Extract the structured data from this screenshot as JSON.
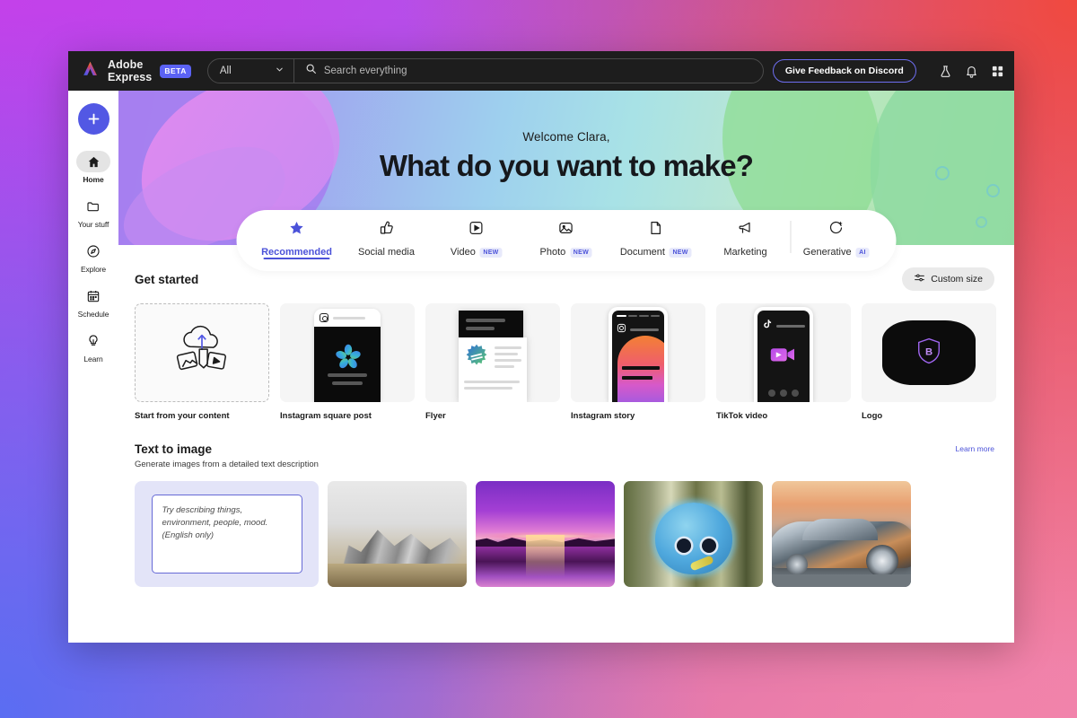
{
  "app": {
    "brand_name": "Adobe Express",
    "beta_label": "BETA"
  },
  "topbar": {
    "scope_value": "All",
    "search_placeholder": "Search everything",
    "feedback_label": "Give Feedback on Discord",
    "icons": [
      "flask-icon",
      "bell-icon",
      "apps-grid-icon",
      "help-icon",
      "creative-cloud-icon"
    ]
  },
  "sidebar": {
    "create_label": "+",
    "items": [
      {
        "label": "Home",
        "icon": "home-icon",
        "active": true
      },
      {
        "label": "Your stuff",
        "icon": "folder-icon",
        "active": false
      },
      {
        "label": "Explore",
        "icon": "compass-icon",
        "active": false
      },
      {
        "label": "Schedule",
        "icon": "calendar-icon",
        "active": false
      },
      {
        "label": "Learn",
        "icon": "lightbulb-icon",
        "active": false
      }
    ]
  },
  "hero": {
    "welcome": "Welcome Clara,",
    "question": "What do you want to make?"
  },
  "tabs": [
    {
      "label": "Recommended",
      "icon": "star-icon",
      "badge": "",
      "active": true
    },
    {
      "label": "Social media",
      "icon": "thumbs-up-icon",
      "badge": "",
      "active": false
    },
    {
      "label": "Video",
      "icon": "play-icon",
      "badge": "NEW",
      "active": false
    },
    {
      "label": "Photo",
      "icon": "image-icon",
      "badge": "NEW",
      "active": false
    },
    {
      "label": "Document",
      "icon": "page-icon",
      "badge": "NEW",
      "active": false
    },
    {
      "label": "Marketing",
      "icon": "megaphone-icon",
      "badge": "",
      "active": false
    },
    {
      "label": "Generative",
      "icon": "sparkle-camera-icon",
      "badge": "AI",
      "active": false
    }
  ],
  "get_started": {
    "title": "Get started",
    "custom_size_label": "Custom size",
    "cards": [
      {
        "label": "Start from your content",
        "kind": "upload"
      },
      {
        "label": "Instagram square post",
        "kind": "ig-post"
      },
      {
        "label": "Flyer",
        "kind": "flyer"
      },
      {
        "label": "Instagram story",
        "kind": "ig-story"
      },
      {
        "label": "TikTok video",
        "kind": "tiktok"
      },
      {
        "label": "Logo",
        "kind": "logo"
      }
    ]
  },
  "text_to_image": {
    "title": "Text to image",
    "subtitle": "Generate images from a detailed text description",
    "learn_more_label": "Learn more",
    "prompt_placeholder": "Try describing things, environment, people, mood. (English only)",
    "samples": [
      {
        "name": "black-and-white-mountains"
      },
      {
        "name": "purple-sunset-lake"
      },
      {
        "name": "blue-fluffy-creature"
      },
      {
        "name": "futuristic-silver-car"
      }
    ]
  },
  "colors": {
    "accent": "#4b52d9",
    "create_button": "#5258e4",
    "topbar_bg": "#1d1d1d",
    "badge_bg": "#e7e9fb"
  }
}
